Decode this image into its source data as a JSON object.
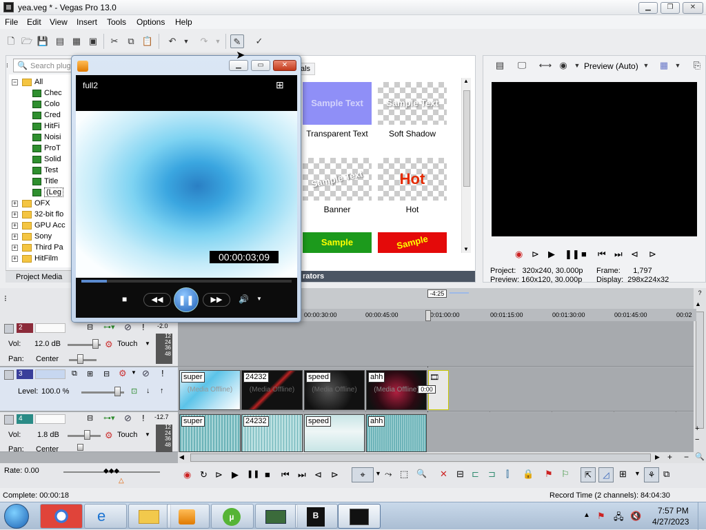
{
  "window": {
    "title": "yea.veg * - Vegas Pro 13.0",
    "controls": [
      "minimize",
      "maximize",
      "close"
    ]
  },
  "menu": [
    "File",
    "Edit",
    "View",
    "Insert",
    "Tools",
    "Options",
    "Help"
  ],
  "plugin_panel": {
    "search_placeholder": "Search plug",
    "tab_label": "Project Media",
    "tree": [
      {
        "label": "All",
        "type": "folder-open"
      },
      {
        "label": "Chec",
        "type": "fx"
      },
      {
        "label": "Colo",
        "type": "fx"
      },
      {
        "label": "Cred",
        "type": "fx"
      },
      {
        "label": "HitFi",
        "type": "fx"
      },
      {
        "label": "Noisi",
        "type": "fx"
      },
      {
        "label": "ProT",
        "type": "fx"
      },
      {
        "label": "Solid",
        "type": "fx"
      },
      {
        "label": "Test",
        "type": "fx"
      },
      {
        "label": "Title",
        "type": "fx"
      },
      {
        "label": "(Leg",
        "type": "fx"
      },
      {
        "label": "OFX",
        "type": "folder"
      },
      {
        "label": "32-bit flo",
        "type": "folder"
      },
      {
        "label": "GPU Acc",
        "type": "folder"
      },
      {
        "label": "Sony",
        "type": "folder"
      },
      {
        "label": "Third Pa",
        "type": "folder"
      },
      {
        "label": "HitFilm",
        "type": "folder"
      }
    ]
  },
  "presets": {
    "tab_fragment": "als",
    "bottom_tab": "rators",
    "items": [
      {
        "thumb": "Sample Text",
        "label": "Transparent Text"
      },
      {
        "thumb": "Sample Text",
        "label": "Soft Shadow"
      },
      {
        "thumb": "Sample Text",
        "label": "Banner"
      },
      {
        "thumb": "Hot",
        "label": "Hot"
      },
      {
        "thumb": "Sample",
        "label": ""
      },
      {
        "thumb": "Sample",
        "label": ""
      }
    ]
  },
  "preview": {
    "mode": "Preview (Auto)",
    "project_label": "Project:",
    "project_value": "320x240, 30.000p",
    "preview_label": "Preview:",
    "preview_value": "160x120, 30.000p",
    "frame_label": "Frame:",
    "frame_value": "1,797",
    "display_label": "Display:",
    "display_value": "298x224x32"
  },
  "player": {
    "title": "full2",
    "timecode": "00:00:03;09",
    "progress": 0.12
  },
  "timeline": {
    "cursor_badge": "-4:25",
    "ruler": [
      "00:00:30:00",
      "00:00:45:00",
      "0:01:00:00",
      "00:01:15:00",
      "00:01:30:00",
      "00:01:45:00",
      "00:02"
    ],
    "tracks": [
      {
        "num": "2",
        "vol_label": "Vol:",
        "vol": "12.0 dB",
        "pan_label": "Pan:",
        "pan": "Center",
        "mode": "Touch",
        "meter_top": "-2.0",
        "meter": [
          "12",
          "24",
          "36",
          "48"
        ]
      },
      {
        "num": "3",
        "level_label": "Level:",
        "level": "100.0 %"
      },
      {
        "num": "4",
        "vol_label": "Vol:",
        "vol": "1.8 dB",
        "pan_label": "Pan:",
        "pan": "Center",
        "mode": "Touch",
        "meter_top": "-12.7",
        "meter": [
          "12",
          "24",
          "36",
          "48"
        ]
      }
    ],
    "video_clips": [
      {
        "label": "super",
        "offline": "(Media Offline)"
      },
      {
        "label": "24232",
        "offline": "(Media Offline)"
      },
      {
        "label": "speed",
        "offline": "(Media Offline)"
      },
      {
        "label": "ahh",
        "offline": "(Media Offline)"
      }
    ],
    "small_clip_time": "0:00",
    "audio_clips": [
      {
        "label": "super"
      },
      {
        "label": "24232"
      },
      {
        "label": "speed"
      },
      {
        "label": "ahh"
      }
    ],
    "rate": "Rate: 0.00"
  },
  "status": {
    "complete": "Complete: 00:00:18",
    "record_time": "Record Time (2 channels): 84:04:30"
  },
  "taskbar": {
    "time": "7:57 PM",
    "date": "4/27/2023"
  }
}
